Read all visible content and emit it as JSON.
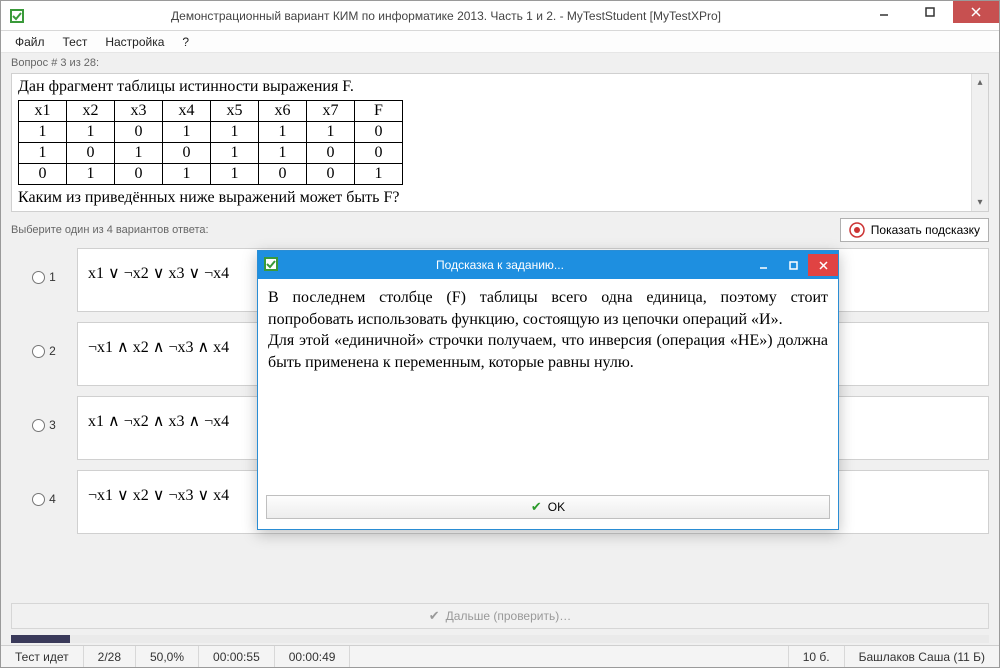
{
  "titlebar": {
    "title": "Демонстрационный вариант КИМ по информатике 2013. Часть 1 и 2. - MyTestStudent [MyTestXPro]"
  },
  "menu": {
    "file": "Файл",
    "test": "Тест",
    "settings": "Настройка",
    "help": "?"
  },
  "question_counter": "Вопрос # 3 из 28:",
  "question": {
    "prompt1": "Дан фрагмент таблицы истинности выражения F.",
    "headers": [
      "x1",
      "x2",
      "x3",
      "x4",
      "x5",
      "x6",
      "x7",
      "F"
    ],
    "rows": [
      [
        "1",
        "1",
        "0",
        "1",
        "1",
        "1",
        "1",
        "0"
      ],
      [
        "1",
        "0",
        "1",
        "0",
        "1",
        "1",
        "0",
        "0"
      ],
      [
        "0",
        "1",
        "0",
        "1",
        "1",
        "0",
        "0",
        "1"
      ]
    ],
    "prompt2": "Каким из приведённых ниже выражений может быть F?"
  },
  "answers_prompt": "Выберите один из 4 вариантов ответа:",
  "hint_button": "Показать подсказку",
  "options": [
    {
      "num": "1",
      "text": "x1 ∨ ¬x2 ∨ x3 ∨ ¬x4"
    },
    {
      "num": "2",
      "text": "¬x1 ∧ x2 ∧ ¬x3 ∧ x4"
    },
    {
      "num": "3",
      "text": "x1 ∧ ¬x2 ∧ x3 ∧ ¬x4"
    },
    {
      "num": "4",
      "text": "¬x1 ∨ x2 ∨ ¬x3 ∨ x4"
    }
  ],
  "next_label": "Дальше (проверить)…",
  "status": {
    "state": "Тест идет",
    "progress": "2/28",
    "percent": "50,0%",
    "t1": "00:00:55",
    "t2": "00:00:49",
    "score": "10 б.",
    "user": "Башлаков Саша (11 Б)"
  },
  "dialog": {
    "title": "Подсказка к заданию...",
    "body": "В последнем столбце (F) таблицы всего одна единица, поэтому стоит попробовать использовать функцию, состоящую из цепочки операций «И».\nДля этой «единичной» строчки получаем, что инверсия (операция «НЕ») должна быть применена к переменным, которые равны нулю.",
    "ok": "OK"
  }
}
